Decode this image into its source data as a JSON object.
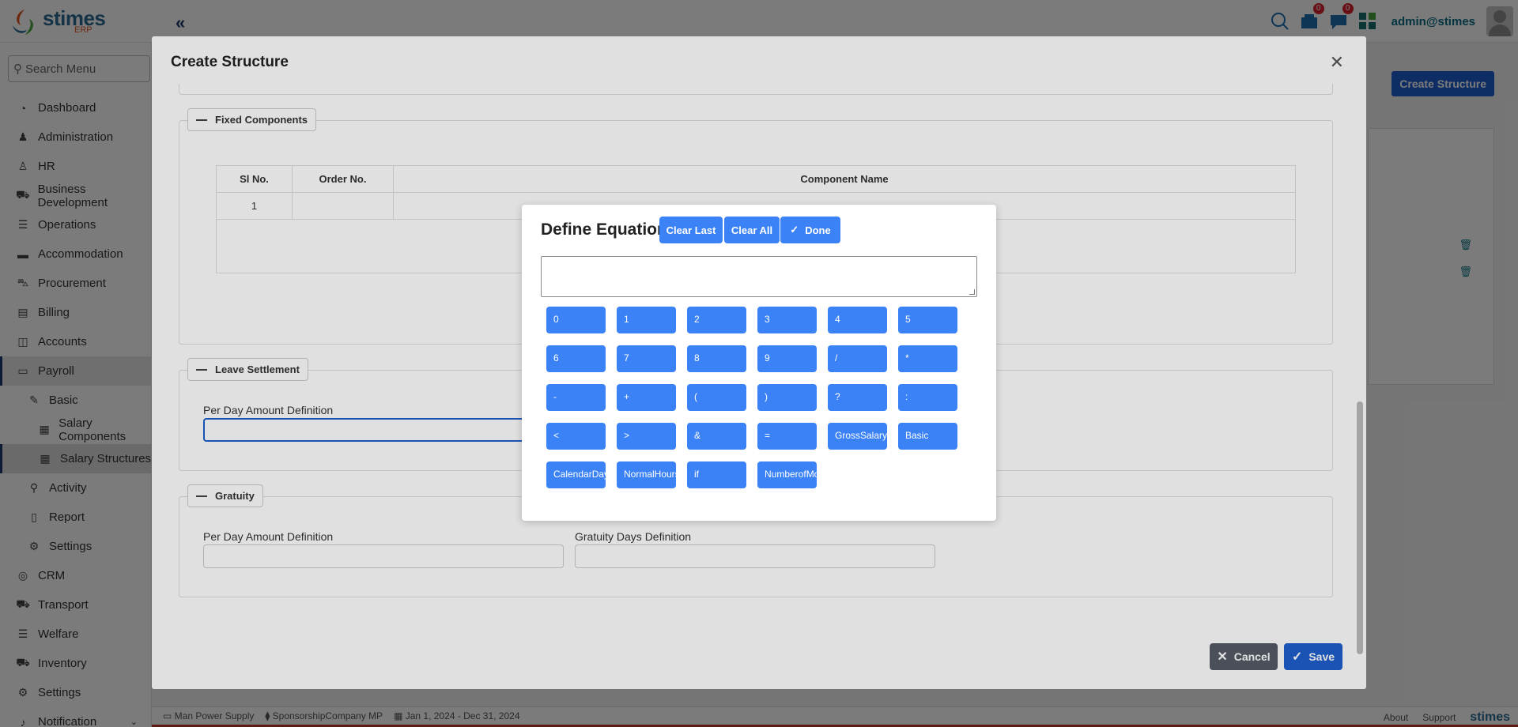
{
  "header": {
    "logo_text": "stimes",
    "logo_sub": "ERP",
    "notifications_count": "0",
    "messages_count": "0",
    "user": "admin@stimes"
  },
  "sidebar": {
    "search_placeholder": "Search Menu",
    "items": [
      {
        "label": "Dashboard",
        "icon": "dashboard-icon",
        "glyph": "◔"
      },
      {
        "label": "Administration",
        "icon": "chair-icon",
        "glyph": "♟"
      },
      {
        "label": "HR",
        "icon": "hr-icon",
        "glyph": "♙"
      },
      {
        "label": "Business Development",
        "icon": "truck-icon",
        "glyph": "⛟"
      },
      {
        "label": "Operations",
        "icon": "sliders-icon",
        "glyph": "☰"
      },
      {
        "label": "Accommodation",
        "icon": "bed-icon",
        "glyph": "▬"
      },
      {
        "label": "Procurement",
        "icon": "cart-icon",
        "glyph": "⛍"
      },
      {
        "label": "Billing",
        "icon": "billing-icon",
        "glyph": "▤"
      },
      {
        "label": "Accounts",
        "icon": "accounts-icon",
        "glyph": "◫"
      },
      {
        "label": "Payroll",
        "icon": "payroll-icon",
        "glyph": "▭"
      },
      {
        "label": "Basic",
        "icon": "pin-icon",
        "glyph": "✎"
      },
      {
        "label": "Salary Components",
        "icon": "table-icon",
        "glyph": "▦"
      },
      {
        "label": "Salary Structures",
        "icon": "table-icon",
        "glyph": "▦"
      },
      {
        "label": "Activity",
        "icon": "walk-icon",
        "glyph": "⚲"
      },
      {
        "label": "Report",
        "icon": "report-icon",
        "glyph": "▯"
      },
      {
        "label": "Settings",
        "icon": "gear-icon",
        "glyph": "⚙"
      },
      {
        "label": "CRM",
        "icon": "crm-icon",
        "glyph": "◎"
      },
      {
        "label": "Transport",
        "icon": "transport-icon",
        "glyph": "⛟"
      },
      {
        "label": "Welfare",
        "icon": "welfare-icon",
        "glyph": "☰"
      },
      {
        "label": "Inventory",
        "icon": "inventory-icon",
        "glyph": "⛟"
      },
      {
        "label": "Settings",
        "icon": "gear-icon",
        "glyph": "⚙"
      },
      {
        "label": "Notification",
        "icon": "bell-icon",
        "glyph": "♪"
      }
    ]
  },
  "background": {
    "create_button": "Create Structure"
  },
  "footer": {
    "company": "Man Power Supply",
    "sponsor": "SponsorshipCompany MP",
    "period": "Jan 1, 2024 - Dec 31, 2024",
    "about": "About",
    "support": "Support",
    "brand": "stimes"
  },
  "modal": {
    "title": "Create Structure",
    "fixed_components": {
      "legend": "Fixed Components",
      "columns": [
        "Sl No.",
        "Order No.",
        "Component Name"
      ],
      "rows": [
        [
          "1",
          "",
          ""
        ]
      ]
    },
    "leave_settlement": {
      "legend": "Leave Settlement",
      "per_day_label": "Per Day Amount Definition"
    },
    "gratuity": {
      "legend": "Gratuity",
      "per_day_label": "Per Day Amount Definition",
      "days_label": "Gratuity Days Definition"
    },
    "cancel_label": "Cancel",
    "save_label": "Save"
  },
  "equation": {
    "title": "Define Equation",
    "clear_last": "Clear Last",
    "clear_all": "Clear All",
    "done": "Done",
    "value": "",
    "keys": [
      "0",
      "1",
      "2",
      "3",
      "4",
      "5",
      "6",
      "7",
      "8",
      "9",
      "/",
      "*",
      "-",
      "+",
      "(",
      ")",
      "?",
      ":",
      "<",
      ">",
      "&",
      "=",
      "GrossSalary",
      "Basic",
      "CalendarDays",
      "NormalHours",
      "if",
      "NumberofMonths"
    ]
  },
  "colors": {
    "primary": "#3b82f6",
    "save": "#1f5fcf",
    "cancel": "#555b66",
    "brand": "#2b6c94"
  }
}
